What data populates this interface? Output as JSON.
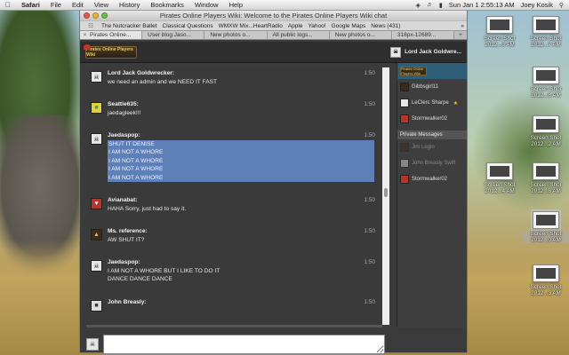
{
  "menubar": {
    "apple": "",
    "items": [
      "Safari",
      "File",
      "Edit",
      "View",
      "History",
      "Bookmarks",
      "Window",
      "Help"
    ],
    "clock": "Sun Jan 1  2:55:13 AM",
    "user": "Joey Kosik"
  },
  "window": {
    "title": "Pirates Online Players Wiki: Welcome to the Pirates Online Players Wiki chat",
    "bookmarks": [
      "The Nutcracker Ballet",
      "Classical Questions",
      "WMXW Mix...HeartRadio",
      "Apple",
      "Yahoo!",
      "Google Maps",
      "News (431)"
    ],
    "tabs": [
      "Pirates Online...",
      "User blog:Jaso...",
      "New photos o...",
      "All public logs...",
      "New photos o...",
      "318px-12689..."
    ]
  },
  "chat": {
    "header_user": "Lord Jack Goldwre...",
    "logo_text": "Pirates Online Players Wiki",
    "messages": [
      {
        "nick": "Lord Jack Goldwrecker:",
        "time": "1:50",
        "lines": [
          "we need an admin and we NEED IT FAST"
        ]
      },
      {
        "nick": "Seattle635:",
        "time": "1:50",
        "lines": [
          "jaedagleek!!!"
        ]
      },
      {
        "nick": "Jaedaspop:",
        "time": "1:50",
        "lines": [
          "SHUT IT DENISE",
          "I AM NOT A WHORE",
          "I AM NOT A WHORE",
          "I AM NOT A WHORE",
          "I AM NOT A WHORE"
        ]
      },
      {
        "nick": "Avianabat:",
        "time": "1:50",
        "lines": [
          "HAHA Sorry, just had to say it."
        ]
      },
      {
        "nick": "Ms. reference:",
        "time": "1:50",
        "lines": [
          "AW SHUT IT?"
        ]
      },
      {
        "nick": "Jaedaspop:",
        "time": "1:50",
        "lines": [
          "I AM NOT A WHORE BUT I LIKE TO DO IT",
          "DANCE DANCE DANCE"
        ]
      },
      {
        "nick": "John Breasly:",
        "time": "1:50",
        "lines": [
          ""
        ]
      }
    ],
    "users": [
      {
        "name": "Gibbsgirl11",
        "dim": false
      },
      {
        "name": "LeClerc Sharpe",
        "dim": false,
        "star": true
      },
      {
        "name": "Stormwalker02",
        "dim": false
      }
    ],
    "private_heading": "Private Messages",
    "private_users": [
      {
        "name": "Jim Legin",
        "dim": true
      },
      {
        "name": "John Breasly Swift",
        "dim": true
      },
      {
        "name": "Stormwalker02",
        "dim": false
      }
    ],
    "input_placeholder": ""
  },
  "desktop_icons": [
    {
      "label": "Screen Shot 2012...3 AM",
      "selected": false
    },
    {
      "label": "Screen Shot 2012...7 AM",
      "selected": false
    },
    {
      "label": "Screen Shot 2012...8 AM",
      "selected": false
    },
    {
      "label": "Screen Shot 2012...2 AM",
      "selected": false
    },
    {
      "label": "Screen Shot 2012...8 AM",
      "selected": false
    },
    {
      "label": "Screen Shot 2012...4 AM",
      "selected": false
    },
    {
      "label": "Screen Shot 2012...0 AM",
      "selected": true
    },
    {
      "label": "Screen Shot 2012...3 AM",
      "selected": false
    }
  ]
}
